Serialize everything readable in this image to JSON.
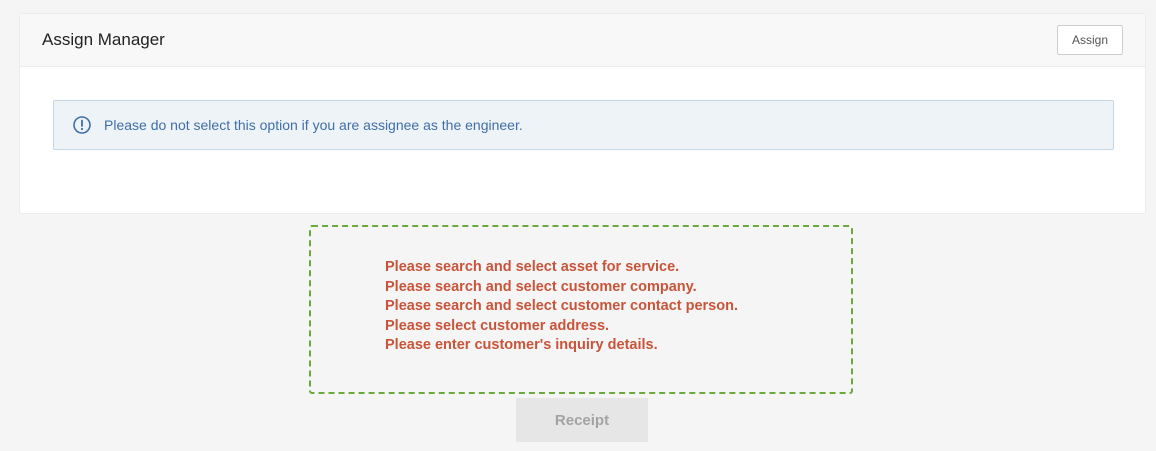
{
  "card": {
    "title": "Assign Manager",
    "assign_label": "Assign",
    "info_icon": "info-circle-icon",
    "info_text": "Please do not select this option if you are assignee as the engineer."
  },
  "errors": [
    "Please search and select asset for service.",
    "Please search and select customer company.",
    "Please search and select customer contact person.",
    "Please select customer address.",
    "Please enter customer's inquiry details."
  ],
  "receipt_label": "Receipt",
  "colors": {
    "info_text": "#3f6fa8",
    "error_text": "#c8543a",
    "dashed_border": "#6aaa3a"
  }
}
